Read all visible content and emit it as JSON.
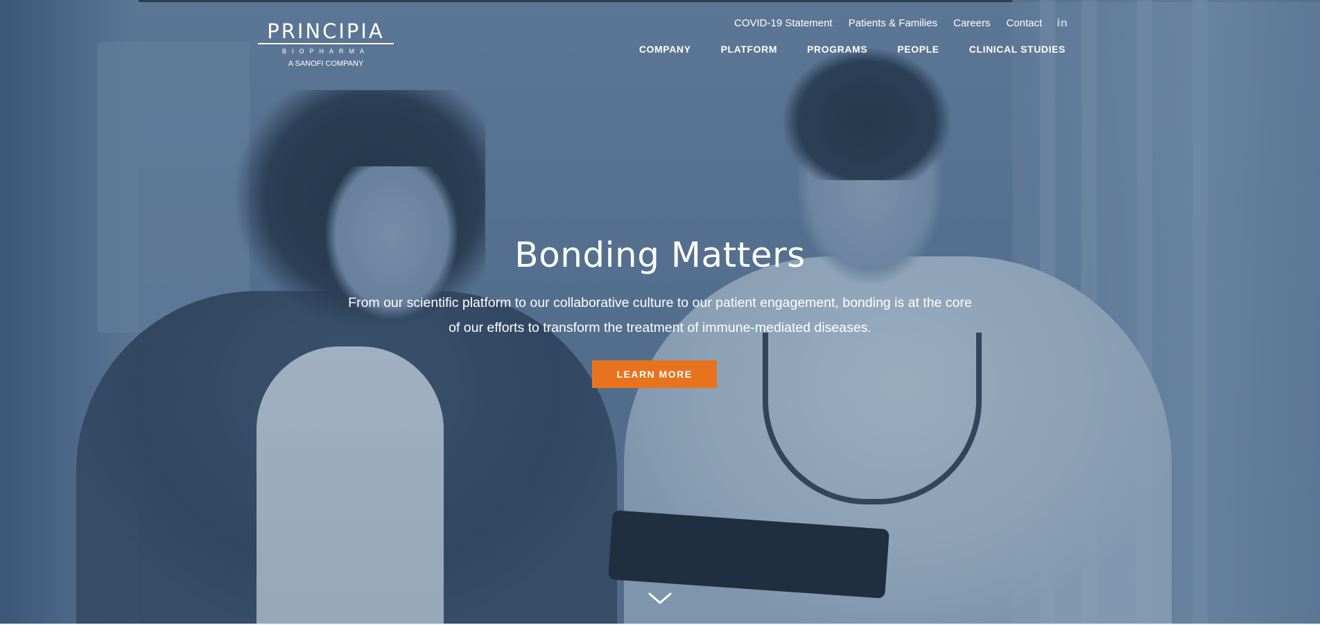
{
  "header": {
    "logo": {
      "wordmark": "PRINCIPIA",
      "subline": "BIOPHARMA",
      "tagline": "A SANOFI COMPANY"
    },
    "utility_nav": [
      {
        "label": "COVID-19 Statement"
      },
      {
        "label": "Patients & Families"
      },
      {
        "label": "Careers"
      },
      {
        "label": "Contact"
      }
    ],
    "social": {
      "icon": "linkedin-icon",
      "glyph": "in"
    },
    "main_nav": [
      {
        "label": "COMPANY"
      },
      {
        "label": "PLATFORM"
      },
      {
        "label": "PROGRAMS"
      },
      {
        "label": "PEOPLE"
      },
      {
        "label": "CLINICAL STUDIES"
      }
    ]
  },
  "hero": {
    "title": "Bonding Matters",
    "subtitle": "From our scientific platform to our collaborative culture to our patient engagement, bonding is at the core of our efforts to transform the treatment of immune-mediated diseases.",
    "cta_label": "LEARN MORE",
    "scroll_icon": "chevron-down-icon"
  },
  "colors": {
    "accent": "#e8731f",
    "overlay": "#5f7a98",
    "text": "#ffffff"
  }
}
